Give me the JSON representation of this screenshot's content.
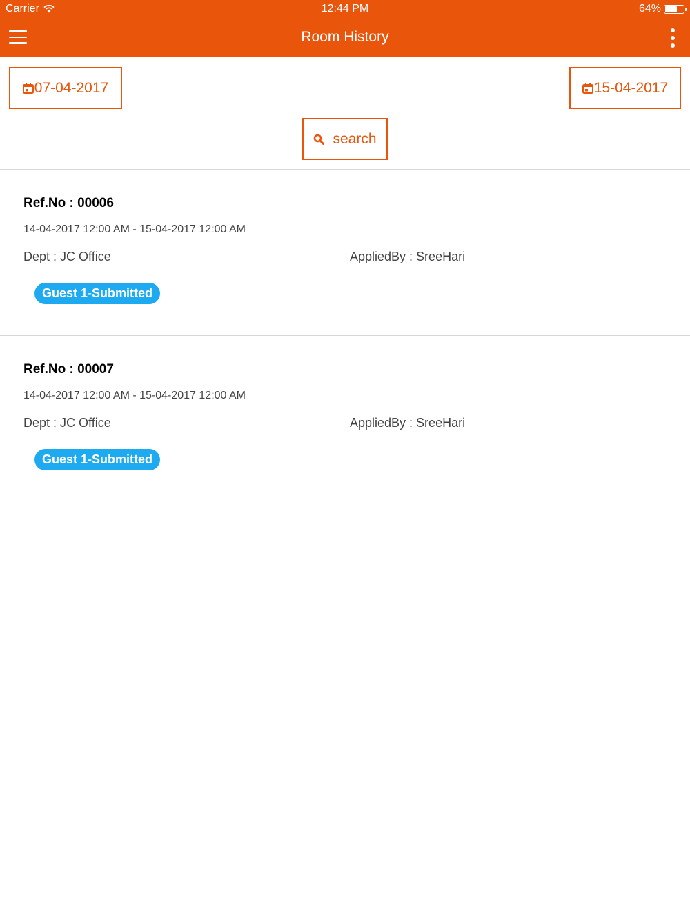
{
  "status_bar": {
    "carrier": "Carrier",
    "time": "12:44 PM",
    "battery": "64%"
  },
  "header": {
    "title": "Room History",
    "background_color": "#e8550b"
  },
  "filters": {
    "from_date": "07-04-2017",
    "to_date": "15-04-2017",
    "search_label": "search",
    "accent_color": "#e8550b"
  },
  "records": [
    {
      "ref": "Ref.No : 00006",
      "dates": "14-04-2017 12:00 AM - 15-04-2017 12:00 AM",
      "dept": "Dept : JC Office",
      "applied_by": "AppliedBy : SreeHari",
      "status": "Guest 1-Submitted"
    },
    {
      "ref": "Ref.No : 00007",
      "dates": "14-04-2017 12:00 AM - 15-04-2017 12:00 AM",
      "dept": "Dept : JC Office",
      "applied_by": "AppliedBy : SreeHari",
      "status": "Guest 1-Submitted"
    }
  ],
  "badge_color": "#1eaaf1"
}
